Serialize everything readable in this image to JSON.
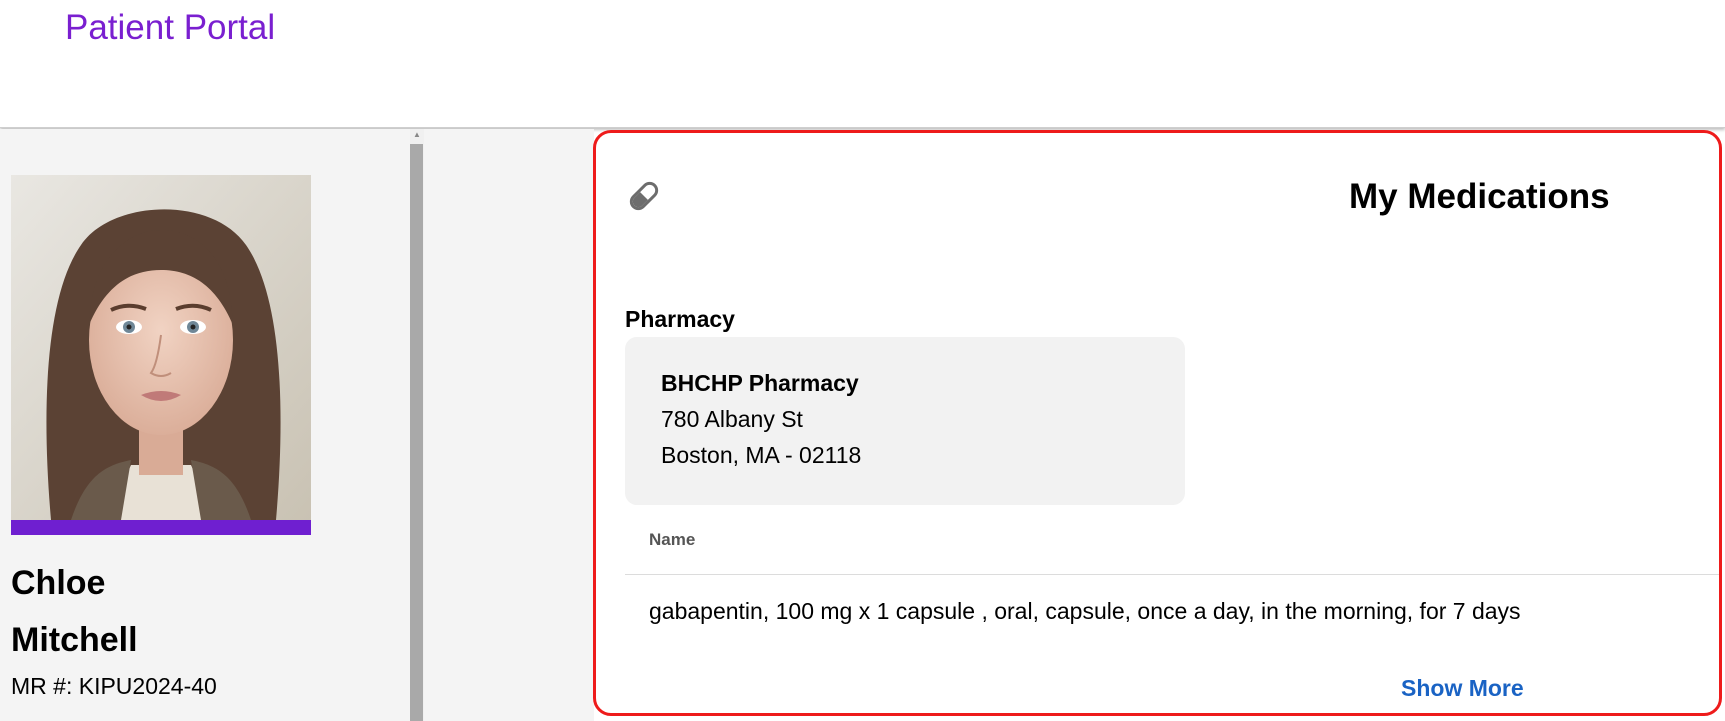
{
  "header": {
    "portal_title": "Patient Portal"
  },
  "patient": {
    "first_name": "Chloe",
    "last_name": "Mitchell",
    "mr_number": "MR #: KIPU2024-40",
    "avatar_accent": "#6f1fd0"
  },
  "medications": {
    "icon": "pill-icon",
    "title": "My Medications",
    "pharmacy_label": "Pharmacy",
    "pharmacy": {
      "name": "BHCHP Pharmacy",
      "address_line1": "780 Albany St",
      "address_line2": "Boston, MA - 02118"
    },
    "table": {
      "columns": [
        "Name"
      ],
      "rows": [
        "gabapentin, 100 mg x 1 capsule , oral, capsule, once a day, in the morning, for 7 days"
      ]
    },
    "show_more_label": "Show More"
  },
  "colors": {
    "brand": "#7a1fd0",
    "highlight_border": "#ee1b1b",
    "link": "#1a63c4"
  }
}
